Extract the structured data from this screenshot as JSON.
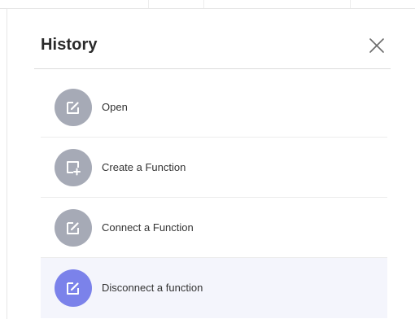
{
  "dialog": {
    "title": "History",
    "close_icon": "close-icon"
  },
  "history": {
    "items": [
      {
        "label": "Open",
        "icon": "edit-icon",
        "active": false
      },
      {
        "label": "Create a Function",
        "icon": "add-box-icon",
        "active": false
      },
      {
        "label": "Connect a Function",
        "icon": "edit-icon",
        "active": false
      },
      {
        "label": "Disconnect a function",
        "icon": "edit-icon",
        "active": true
      }
    ]
  },
  "colors": {
    "icon_circle": "#a6aab6",
    "icon_circle_active": "#7b82ea",
    "active_row_bg": "#f4f5fc",
    "title_text": "#2a2a2a"
  }
}
